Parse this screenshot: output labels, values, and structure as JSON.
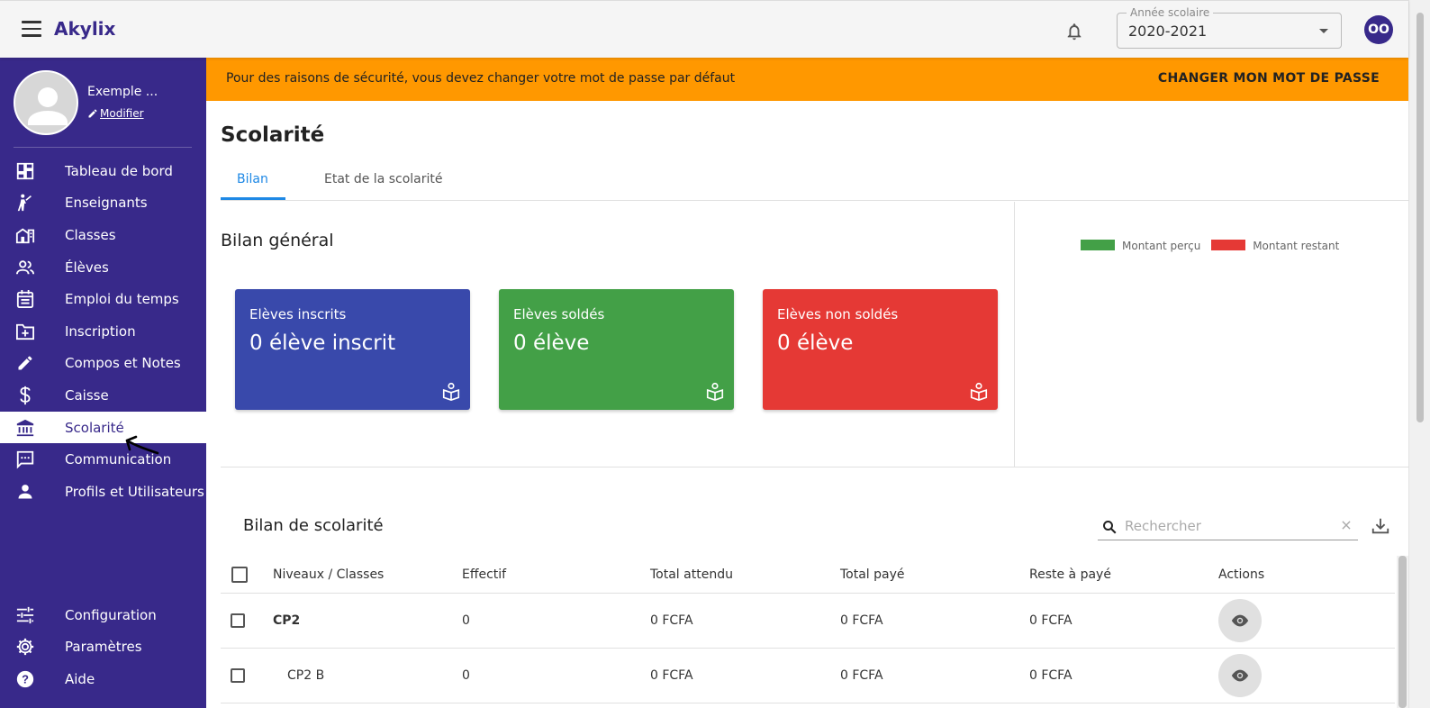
{
  "app": {
    "brand": "Akylix"
  },
  "topbar": {
    "year_label": "Année scolaire",
    "year_value": "2020-2021",
    "user_initials": "OO"
  },
  "profile": {
    "name": "Exemple ...",
    "edit_label": "Modifier"
  },
  "sidebar": {
    "items": [
      {
        "label": "Tableau de bord",
        "icon": "dashboard-icon"
      },
      {
        "label": "Enseignants",
        "icon": "teacher-icon"
      },
      {
        "label": "Classes",
        "icon": "school-building-icon"
      },
      {
        "label": "Élèves",
        "icon": "students-icon"
      },
      {
        "label": "Emploi du temps",
        "icon": "calendar-icon"
      },
      {
        "label": "Inscription",
        "icon": "folder-add-icon"
      },
      {
        "label": "Compos et Notes",
        "icon": "pencil-icon"
      },
      {
        "label": "Caisse",
        "icon": "dollar-icon"
      },
      {
        "label": "Scolarité",
        "icon": "bank-icon",
        "active": true
      },
      {
        "label": "Communication",
        "icon": "message-icon"
      },
      {
        "label": "Profils et Utilisateurs",
        "icon": "person-icon"
      }
    ],
    "bottom_items": [
      {
        "label": "Configuration",
        "icon": "tune-icon"
      },
      {
        "label": "Paramètres",
        "icon": "gear-icon"
      },
      {
        "label": "Aide",
        "icon": "help-icon"
      }
    ]
  },
  "banner": {
    "text": "Pour des raisons de sécurité, vous devez changer votre mot de passe par défaut",
    "action": "CHANGER MON MOT DE PASSE",
    "color": "#ff9800"
  },
  "page": {
    "title": "Scolarité",
    "tabs": [
      {
        "label": "Bilan",
        "active": true
      },
      {
        "label": "Etat de la scolarité"
      }
    ]
  },
  "general": {
    "title": "Bilan général",
    "cards": [
      {
        "label": "Elèves inscrits",
        "value": "0 élève inscrit",
        "color": "#3949ab"
      },
      {
        "label": "Elèves soldés",
        "value": "0 élève",
        "color": "#43a047"
      },
      {
        "label": "Elèves non soldés",
        "value": "0 élève",
        "color": "#e53935"
      }
    ],
    "legend": [
      {
        "label": "Montant perçu",
        "color": "#43a047"
      },
      {
        "label": "Montant restant",
        "color": "#e53935"
      }
    ]
  },
  "bilan": {
    "title": "Bilan de scolarité",
    "search_placeholder": "Rechercher",
    "columns": [
      "Niveaux / Classes",
      "Effectif",
      "Total attendu",
      "Total payé",
      "Reste à payé",
      "Actions"
    ],
    "rows": [
      {
        "name": "CP2",
        "effectif": "0",
        "attendu": "0 FCFA",
        "paye": "0 FCFA",
        "reste": "0 FCFA"
      },
      {
        "name": "CP2 B",
        "effectif": "0",
        "attendu": "0 FCFA",
        "paye": "0 FCFA",
        "reste": "0 FCFA"
      }
    ]
  },
  "colors": {
    "primary": "#38298a",
    "accent": "#1e88e5"
  }
}
